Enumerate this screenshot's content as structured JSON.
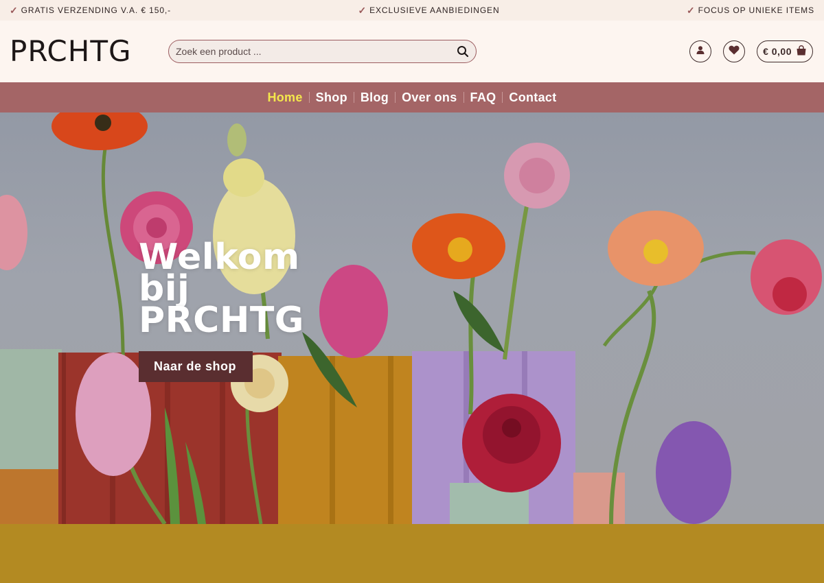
{
  "topbar": {
    "usps": [
      "GRATIS VERZENDING V.A. € 150,-",
      "EXCLUSIEVE AANBIEDINGEN",
      "FOCUS OP UNIEKE ITEMS"
    ]
  },
  "header": {
    "logo": "PRCHTG",
    "search_placeholder": "Zoek een product ...",
    "cart_total": "€ 0,00",
    "icons": [
      "user-icon",
      "heart-icon",
      "shopping-bag-icon"
    ]
  },
  "nav": {
    "items": [
      {
        "label": "Home"
      },
      {
        "label": "Shop"
      },
      {
        "label": "Blog"
      },
      {
        "label": "Over ons"
      },
      {
        "label": "FAQ"
      },
      {
        "label": "Contact"
      }
    ]
  },
  "hero": {
    "title": "Welkom bij PRCHTG",
    "cta_label": "Naar de shop"
  },
  "colors": {
    "nav_background": "#a46566",
    "nav_active": "#f4e74c",
    "topbar_background": "#f8eee7",
    "header_background": "#fdf5f0",
    "cta_background": "#5a2e30",
    "bottom_band": "#b38a22"
  }
}
